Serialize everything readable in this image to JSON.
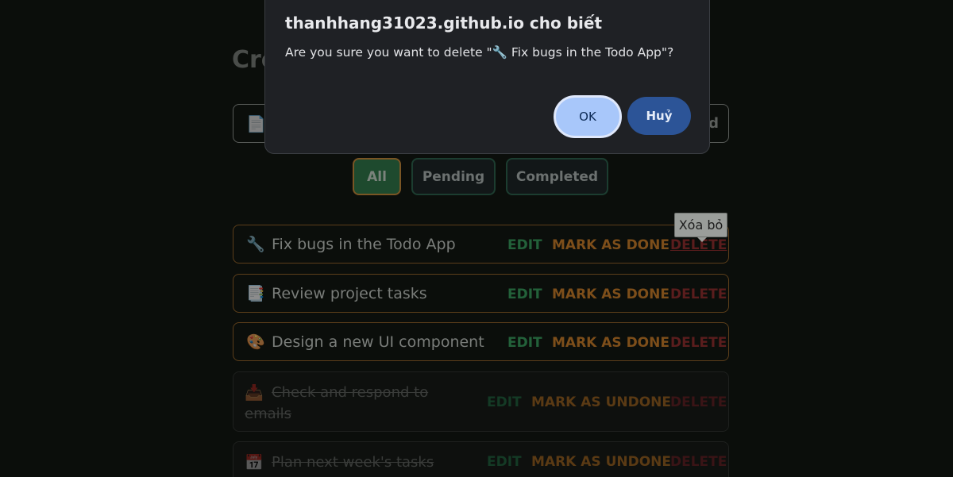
{
  "page": {
    "title_fragment": "Cre",
    "add_button_fragment": "d",
    "new_task_icon": "memo-icon"
  },
  "filters": [
    {
      "label": "All",
      "active": true
    },
    {
      "label": "Pending",
      "active": false
    },
    {
      "label": "Completed",
      "active": false
    }
  ],
  "todos": [
    {
      "icon": "🔧",
      "icon_name": "wrench-icon",
      "text": "Fix bugs in the Todo App",
      "completed": false,
      "edit": "EDIT",
      "mark": "MARK AS DONE",
      "delete": "DELETE"
    },
    {
      "icon": "📑",
      "icon_name": "document-icon",
      "text": "Review project tasks",
      "completed": false,
      "edit": "EDIT",
      "mark": "MARK AS DONE",
      "delete": "DELETE"
    },
    {
      "icon": "🎨",
      "icon_name": "palette-icon",
      "text": "Design a new UI component",
      "completed": false,
      "edit": "EDIT",
      "mark": "MARK AS DONE",
      "delete": "DELETE"
    },
    {
      "icon": "📥",
      "icon_name": "inbox-icon",
      "text": "Check and respond to emails",
      "completed": true,
      "edit": "EDIT",
      "mark": "MARK AS UNDONE",
      "delete": "DELETE"
    },
    {
      "icon": "📅",
      "icon_name": "calendar-icon",
      "text": "Plan next week's tasks",
      "completed": true,
      "edit": "EDIT",
      "mark": "MARK AS UNDONE",
      "delete": "DELETE"
    }
  ],
  "tooltip": {
    "text": "Xóa bỏ"
  },
  "dialog": {
    "title": "thanhhang31023.github.io cho biết",
    "message": "Are you sure you want to delete \"🔧 Fix bugs in the Todo App\"?",
    "ok_label": "OK",
    "cancel_label": "Huỷ"
  },
  "colors": {
    "ok_button": "#a8c7fa",
    "cancel_button": "#2c5497",
    "dialog_bg": "#1f2125",
    "edit_green": "#23613a",
    "mark_orange": "#7d4e1a",
    "delete_red": "#5a1d1d"
  }
}
